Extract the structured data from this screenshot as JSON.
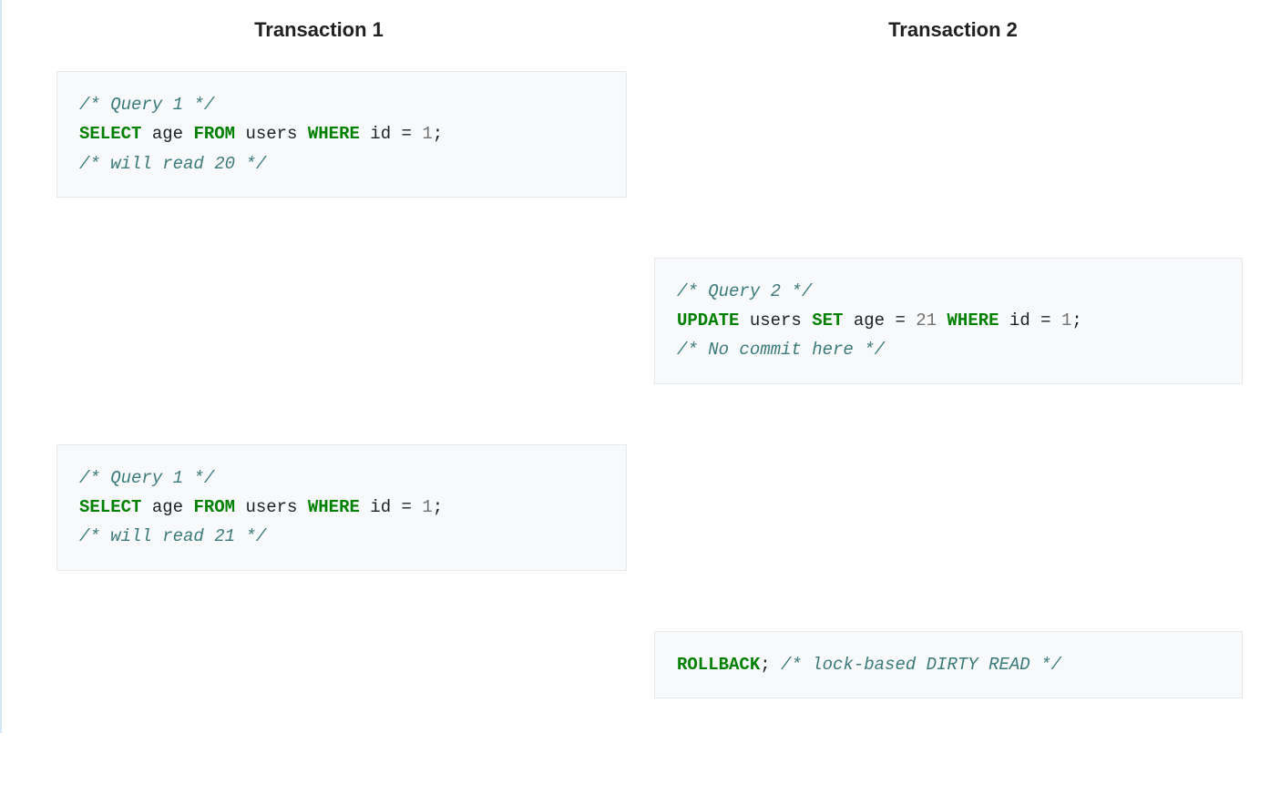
{
  "headers": {
    "col1": "Transaction 1",
    "col2": "Transaction 2"
  },
  "rows": [
    {
      "col1": {
        "tokens": [
          {
            "cls": "cm",
            "t": "/* Query 1 */"
          },
          {
            "cls": "nl"
          },
          {
            "cls": "kw",
            "t": "SELECT"
          },
          {
            "cls": "tx",
            "t": " age "
          },
          {
            "cls": "kw",
            "t": "FROM"
          },
          {
            "cls": "tx",
            "t": " users "
          },
          {
            "cls": "kw",
            "t": "WHERE"
          },
          {
            "cls": "tx",
            "t": " id = "
          },
          {
            "cls": "num",
            "t": "1"
          },
          {
            "cls": "tx",
            "t": ";"
          },
          {
            "cls": "nl"
          },
          {
            "cls": "cm",
            "t": "/* will read 20 */"
          }
        ]
      },
      "col2": null
    },
    {
      "gap": true
    },
    {
      "col1": null,
      "col2": {
        "tokens": [
          {
            "cls": "cm",
            "t": "/* Query 2 */"
          },
          {
            "cls": "nl"
          },
          {
            "cls": "kw",
            "t": "UPDATE"
          },
          {
            "cls": "tx",
            "t": " users "
          },
          {
            "cls": "kw",
            "t": "SET"
          },
          {
            "cls": "tx",
            "t": " age = "
          },
          {
            "cls": "num",
            "t": "21"
          },
          {
            "cls": "tx",
            "t": " "
          },
          {
            "cls": "kw",
            "t": "WHERE"
          },
          {
            "cls": "tx",
            "t": " id = "
          },
          {
            "cls": "num",
            "t": "1"
          },
          {
            "cls": "tx",
            "t": ";"
          },
          {
            "cls": "nl"
          },
          {
            "cls": "cm",
            "t": "/* No commit here */"
          }
        ]
      }
    },
    {
      "gap": true
    },
    {
      "col1": {
        "tokens": [
          {
            "cls": "cm",
            "t": "/* Query 1 */"
          },
          {
            "cls": "nl"
          },
          {
            "cls": "kw",
            "t": "SELECT"
          },
          {
            "cls": "tx",
            "t": " age "
          },
          {
            "cls": "kw",
            "t": "FROM"
          },
          {
            "cls": "tx",
            "t": " users "
          },
          {
            "cls": "kw",
            "t": "WHERE"
          },
          {
            "cls": "tx",
            "t": " id = "
          },
          {
            "cls": "num",
            "t": "1"
          },
          {
            "cls": "tx",
            "t": ";"
          },
          {
            "cls": "nl"
          },
          {
            "cls": "cm",
            "t": "/* will read 21 */"
          }
        ]
      },
      "col2": null
    },
    {
      "gap": true
    },
    {
      "col1": null,
      "col2": {
        "tokens": [
          {
            "cls": "kw",
            "t": "ROLLBACK"
          },
          {
            "cls": "tx",
            "t": "; "
          },
          {
            "cls": "cm",
            "t": "/* lock-based DIRTY READ */"
          }
        ]
      }
    }
  ]
}
